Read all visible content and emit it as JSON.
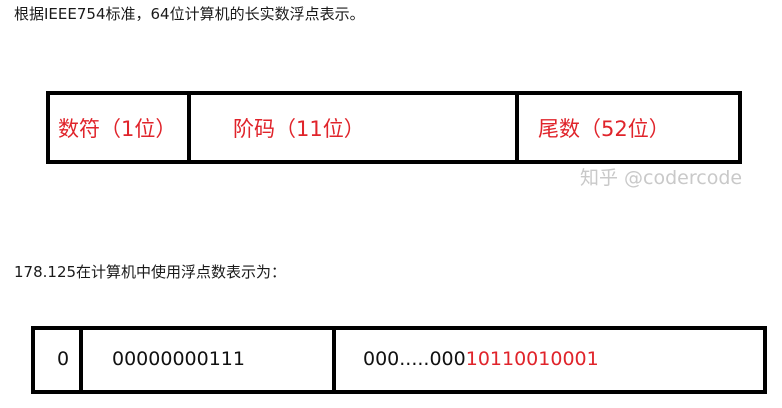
{
  "intro_text": "根据IEEE754标准，64位计算机的长实数浮点表示。",
  "format_diagram": {
    "sign_label": "数符（1位）",
    "exponent_label": "阶码（11位）",
    "mantissa_label": "尾数（52位）",
    "label_color": "#e0242b"
  },
  "watermark": "知乎 @codercode",
  "example_text": "178.125在计算机中使用浮点数表示为：",
  "value_diagram": {
    "sign": "0",
    "exponent": "00000000111",
    "mantissa_prefix": "000.....000",
    "mantissa_highlight": "10110010001",
    "highlight_color": "#e0242b"
  }
}
